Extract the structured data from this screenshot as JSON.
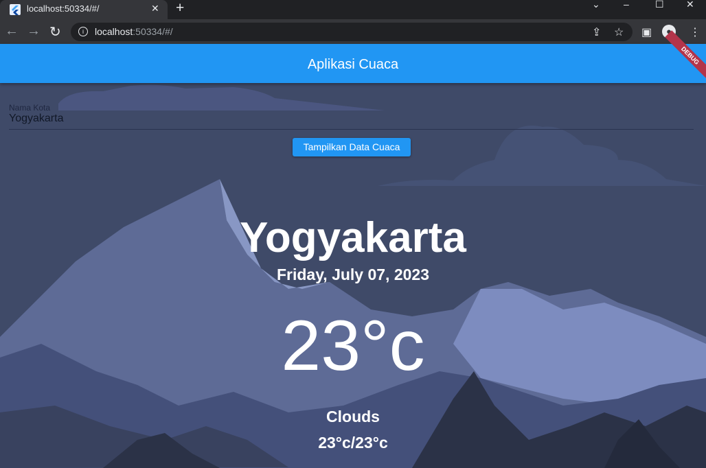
{
  "browser": {
    "tab_title": "localhost:50334/#/",
    "url_host": "localhost",
    "url_rest": ":50334/#/",
    "icons": [
      "back-icon",
      "forward-icon",
      "reload-icon",
      "info-icon",
      "share-icon",
      "star-icon",
      "sidepanel-icon",
      "profile-icon",
      "menu-icon",
      "close-icon",
      "new-tab-icon"
    ]
  },
  "appbar": {
    "title": "Aplikasi Cuaca",
    "debug_banner": "DEBUG"
  },
  "form": {
    "label": "Nama Kota",
    "value": "Yogyakarta",
    "button": "Tampilkan Data Cuaca"
  },
  "weather": {
    "city": "Yogyakarta",
    "date": "Friday, July 07, 2023",
    "temperature": "23°c",
    "description": "Clouds",
    "range": "23°c/23°c"
  },
  "colors": {
    "accent": "#2196f3",
    "background": "#3f4a68"
  }
}
